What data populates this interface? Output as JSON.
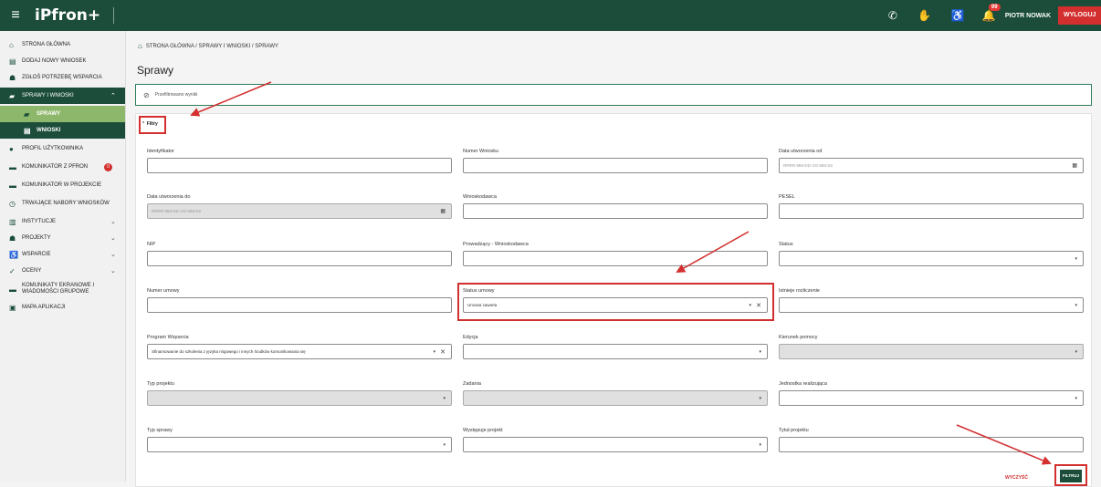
{
  "topbar": {
    "logo": "iPfron+",
    "notification_count": "99",
    "user_name": "PIOTR NOWAK",
    "logout_label": "WYLOGUJ"
  },
  "sidebar": {
    "items": [
      {
        "label": "STRONA GŁÓWNA",
        "icon": "home-icon"
      },
      {
        "label": "DODAJ NOWY WNIOSEK",
        "icon": "document-icon"
      },
      {
        "label": "ZGŁOŚ POTRZEBĘ WSPARCIA",
        "icon": "people-icon"
      },
      {
        "label": "SPRAWY I WNIOSKI",
        "icon": "briefcase-icon"
      },
      {
        "label": "SPRAWY",
        "icon": "briefcase-icon"
      },
      {
        "label": "WNIOSKI",
        "icon": "document-icon"
      },
      {
        "label": "PROFIL UŻYTKOWNIKA",
        "icon": "user-icon"
      },
      {
        "label": "KOMUNIKATOR Z PFRON",
        "icon": "chat-icon",
        "badge": "0"
      },
      {
        "label": "KOMUNIKATOR W PROJEKCIE",
        "icon": "chat-icon"
      },
      {
        "label": "TRWAJĄCE NABORY WNIOSKÓW",
        "icon": "clock-icon"
      },
      {
        "label": "INSTYTUCJE",
        "icon": "building-icon"
      },
      {
        "label": "PROJEKTY",
        "icon": "people-icon"
      },
      {
        "label": "WSPARCIE",
        "icon": "accessibility-icon"
      },
      {
        "label": "OCENY",
        "icon": "check-icon"
      },
      {
        "label": "KOMUNIKATY EKRANOWE I WIADOMOŚCI GRUPOWE",
        "icon": "message-icon"
      },
      {
        "label": "MAPA APLIKACJI",
        "icon": "map-icon"
      }
    ]
  },
  "main": {
    "breadcrumb": "STRONA GŁÓWNA / SPRAWY I WNIOSKI / SPRAWY",
    "title": "Sprawy",
    "banner": "Przefiltrowano wyniki",
    "filters_label": "Filtry",
    "fields": {
      "identyfikator": {
        "label": "Identyfikator",
        "value": ""
      },
      "numer_wniosku": {
        "label": "Numer Wniosku",
        "value": ""
      },
      "data_od": {
        "label": "Data utworzenia od",
        "placeholder": "RRRR-MM-DD GG:MM:SS"
      },
      "data_do": {
        "label": "Data utworzenia do",
        "placeholder": "RRRR-MM-DD GG:MM:SS"
      },
      "wnioskodawca": {
        "label": "Wnioskodawca",
        "value": ""
      },
      "pesel": {
        "label": "PESEL",
        "value": ""
      },
      "nip": {
        "label": "NIP",
        "value": ""
      },
      "prowadzacy": {
        "label": "Prowadzący - Wnioskodawca",
        "value": ""
      },
      "status": {
        "label": "Status",
        "value": ""
      },
      "numer_umowy": {
        "label": "Numer umowy",
        "value": ""
      },
      "status_umowy": {
        "label": "Status umowy",
        "value": "Umowa zawarta"
      },
      "istnieje_rozliczenie": {
        "label": "Istnieje rozliczenie",
        "value": ""
      },
      "program_wsparcia": {
        "label": "Program Wsparcia",
        "value": "Sfinansowanie do szkolenia z języka migowego i innych środków komunikowania się"
      },
      "edycja": {
        "label": "Edycja",
        "value": ""
      },
      "kierunek_pomocy": {
        "label": "Kierunek pomocy",
        "value": ""
      },
      "typ_projektu": {
        "label": "Typ projektu",
        "value": ""
      },
      "zadania": {
        "label": "Zadania",
        "value": ""
      },
      "jednostka": {
        "label": "Jednostka realizująca",
        "value": ""
      },
      "typ_sprawy": {
        "label": "Typ sprawy",
        "value": ""
      },
      "wystepuje_projekt": {
        "label": "Występuje projekt",
        "value": ""
      },
      "tytul_projektu": {
        "label": "Tytuł projektu",
        "value": ""
      }
    },
    "clear_label": "WYCZYŚĆ",
    "filter_label": "FILTRUJ"
  },
  "colors": {
    "brand": "#1b4d3a",
    "accent": "#8db86c",
    "annotation": "#d32f2f"
  }
}
